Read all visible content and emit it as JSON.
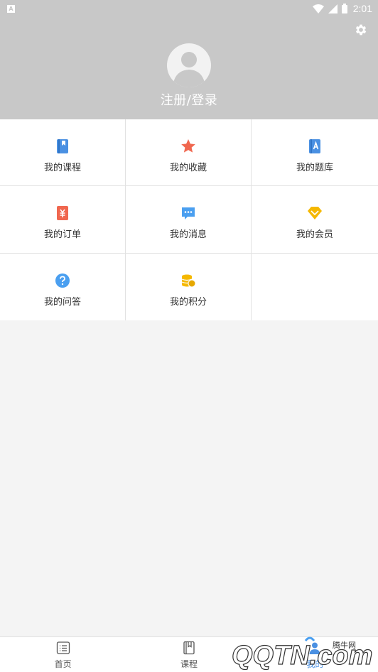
{
  "status_bar": {
    "time": "2:01"
  },
  "header": {
    "login_label": "注册/登录"
  },
  "grid": [
    {
      "label": "我的课程",
      "icon": "book-icon",
      "color": "#4a90e2"
    },
    {
      "label": "我的收藏",
      "icon": "star-icon",
      "color": "#f0674f"
    },
    {
      "label": "我的题库",
      "icon": "question-bank-icon",
      "color": "#4a90e2"
    },
    {
      "label": "我的订单",
      "icon": "order-icon",
      "color": "#f0674f"
    },
    {
      "label": "我的消息",
      "icon": "message-icon",
      "color": "#4a9ff0"
    },
    {
      "label": "我的会员",
      "icon": "vip-diamond-icon",
      "color": "#f5b800"
    },
    {
      "label": "我的问答",
      "icon": "question-icon",
      "color": "#4a9ff0"
    },
    {
      "label": "我的积分",
      "icon": "coins-icon",
      "color": "#f5b800"
    }
  ],
  "bottom_nav": [
    {
      "label": "首页",
      "icon": "home-list-icon"
    },
    {
      "label": "课程",
      "icon": "course-book-icon"
    },
    {
      "label": "我的",
      "icon": "profile-icon"
    }
  ],
  "watermark": {
    "brand": "QQTN.com",
    "text": "腾牛网"
  },
  "colors": {
    "header_bg": "#c8c8c8",
    "page_bg": "#f4f4f4"
  }
}
